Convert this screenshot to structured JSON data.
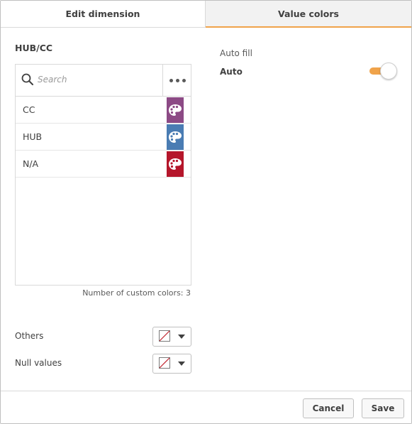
{
  "tabs": {
    "edit_dimension": "Edit dimension",
    "value_colors": "Value colors"
  },
  "section_title": "HUB/CC",
  "search": {
    "placeholder": "Search",
    "value": ""
  },
  "items": [
    {
      "label": "CC",
      "color": "#8c4a85"
    },
    {
      "label": "HUB",
      "color": "#4a7cb3"
    },
    {
      "label": "N/A",
      "color": "#b5162b"
    }
  ],
  "custom_colors_text": "Number of custom colors: 3",
  "others_label": "Others",
  "null_values_label": "Null values",
  "auto_fill_label": "Auto fill",
  "auto_label": "Auto",
  "auto_toggle_on": true,
  "accent_color": "#f0a34a",
  "buttons": {
    "cancel": "Cancel",
    "save": "Save"
  },
  "icons": {
    "search": "search-icon",
    "more": "more-horizontal-icon",
    "palette": "palette-icon",
    "no_color": "no-color-icon",
    "caret": "caret-down-icon"
  }
}
